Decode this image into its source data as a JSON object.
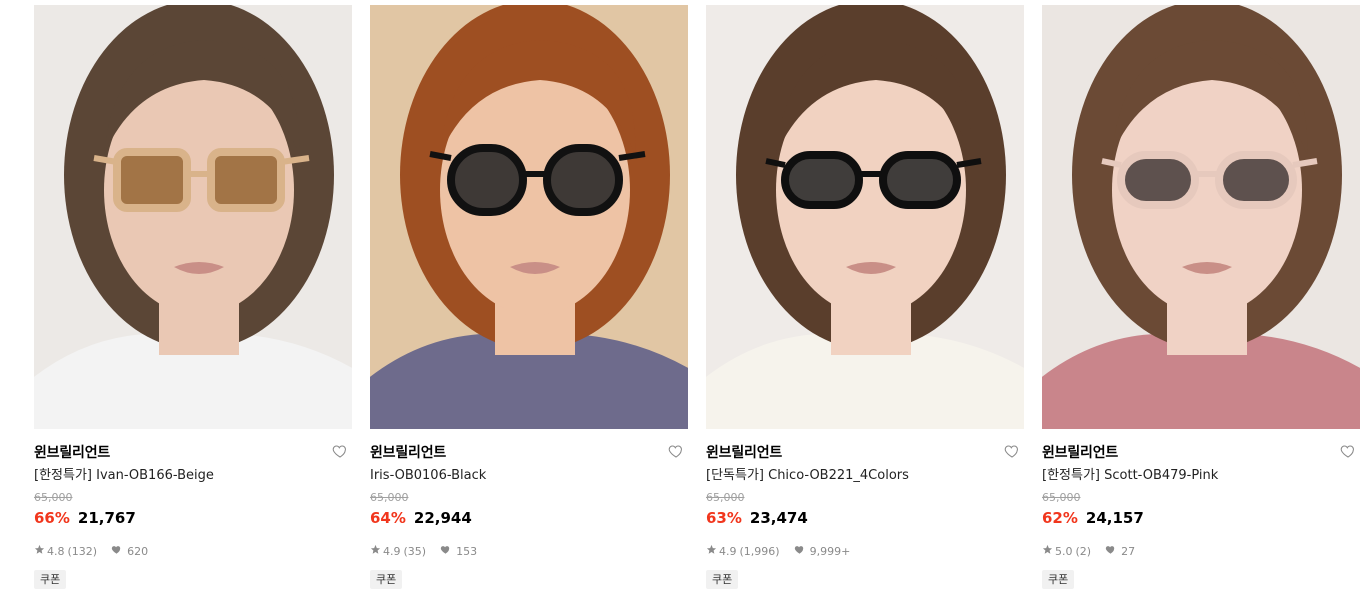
{
  "products": [
    {
      "brand": "윈브릴리언트",
      "title": "[한정특가] Ivan-OB166-Beige",
      "original_price": "65,000",
      "discount": "66%",
      "price": "21,767",
      "rating": "4.8",
      "reviews": "(132)",
      "likes": "620",
      "coupon": "쿠폰",
      "image": {
        "bg": "#ece9e6",
        "hair": "#5b4636",
        "skin": "#eac8b4",
        "clothes": "#f3f3f3",
        "frame": "#d9b38a",
        "lens": "#9a6a3a",
        "style": "square"
      }
    },
    {
      "brand": "윈브릴리언트",
      "title": "Iris-OB0106-Black",
      "original_price": "65,000",
      "discount": "64%",
      "price": "22,944",
      "rating": "4.9",
      "reviews": "(35)",
      "likes": "153",
      "coupon": "쿠폰",
      "image": {
        "bg": "#e1c6a4",
        "hair": "#9e4f22",
        "skin": "#eec3a5",
        "clothes": "#6e6b8c",
        "frame": "#111111",
        "lens": "#2a2a2a",
        "style": "round"
      }
    },
    {
      "brand": "윈브릴리언트",
      "title": "[단독특가] Chico-OB221_4Colors",
      "original_price": "65,000",
      "discount": "63%",
      "price": "23,474",
      "rating": "4.9",
      "reviews": "(1,996)",
      "likes": "9,999+",
      "coupon": "쿠폰",
      "image": {
        "bg": "#efebe8",
        "hair": "#5a3e2c",
        "skin": "#f1d2c1",
        "clothes": "#f6f3ec",
        "frame": "#0f0f0f",
        "lens": "#2c2c2c",
        "style": "oval"
      }
    },
    {
      "brand": "윈브릴리언트",
      "title": "[한정특가] Scott-OB479-Pink",
      "original_price": "65,000",
      "discount": "62%",
      "price": "24,157",
      "rating": "5.0",
      "reviews": "(2)",
      "likes": "27",
      "coupon": "쿠폰",
      "image": {
        "bg": "#ebe6e2",
        "hair": "#6b4a35",
        "skin": "#f0d2c5",
        "clothes": "#c9858b",
        "frame": "#e6c9bd",
        "lens": "#4e4240",
        "style": "oval"
      }
    }
  ],
  "colors": {
    "discount": "#f1361d",
    "muted": "#8a8a8a",
    "strike": "#a0a0a0",
    "badge_bg": "#f1f1f1"
  },
  "icons": {
    "wish": "heart-outline-icon",
    "star": "star-icon",
    "like": "heart-filled-icon"
  }
}
